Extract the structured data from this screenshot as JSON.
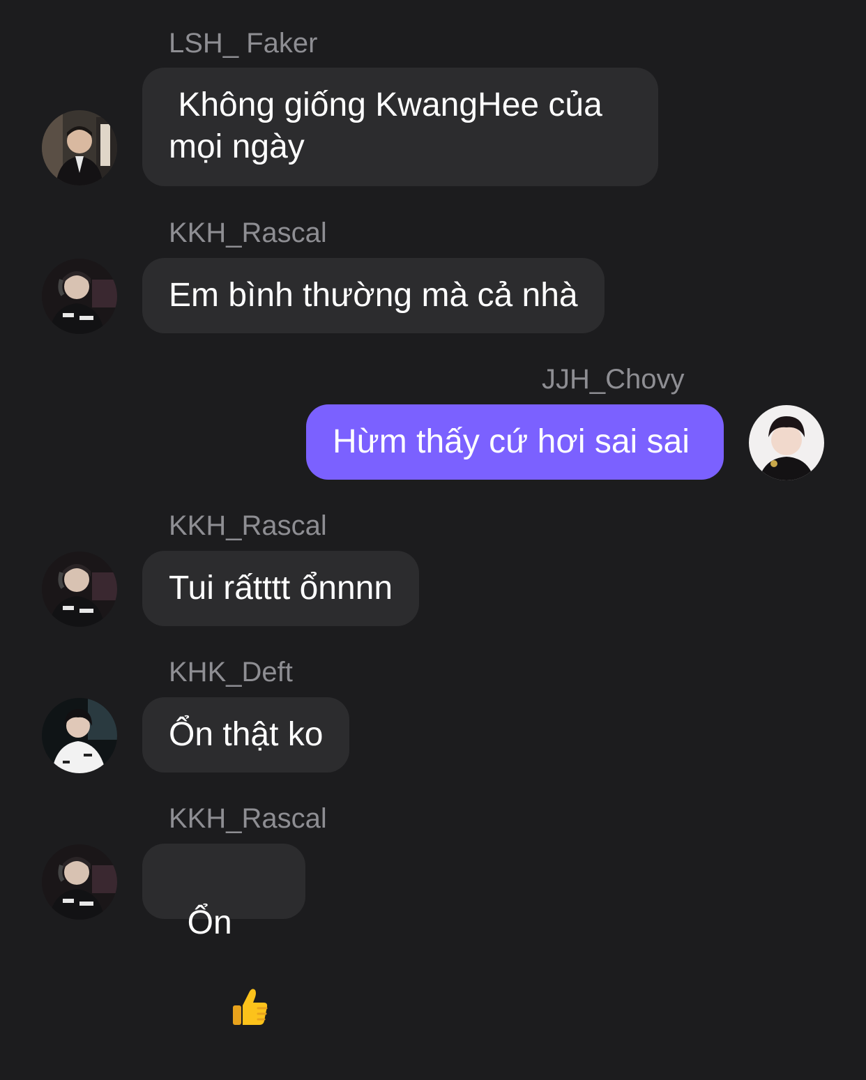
{
  "messages": [
    {
      "sender": "LSH_ Faker",
      "text": " Không giống KwangHee của mọi ngày",
      "outgoing": false
    },
    {
      "sender": "KKH_Rascal",
      "text": "Em bình thường mà cả nhà",
      "outgoing": false
    },
    {
      "sender": "JJH_Chovy",
      "text": "Hừm thấy cứ hơi sai sai",
      "outgoing": true
    },
    {
      "sender": "KKH_Rascal",
      "text": "Tui rấtttt ổnnnn",
      "outgoing": false
    },
    {
      "sender": "KHK_Deft",
      "text": "Ổn thật ko",
      "outgoing": false
    },
    {
      "sender": "KKH_Rascal",
      "text": "Ổn",
      "emoji": "thumbs-up-icon",
      "outgoing": false
    }
  ],
  "colors": {
    "background": "#1c1c1e",
    "incoming_bubble": "#2c2c2e",
    "outgoing_bubble": "#7b61ff",
    "sender_name": "#8e8e93",
    "message_text": "#ffffff"
  }
}
